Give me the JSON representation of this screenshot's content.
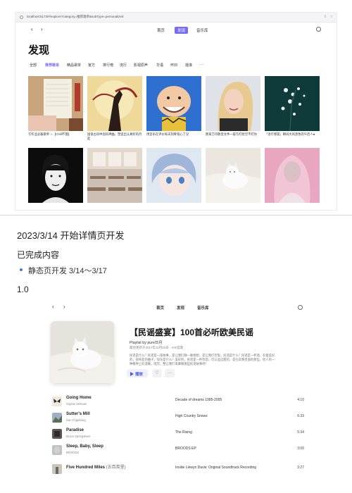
{
  "browser": {
    "url": "localhost:5173/#/explore?category=推荐歌单&subType=personalized"
  },
  "discover_page": {
    "nav_tabs": [
      "首页",
      "发现",
      "音乐库"
    ],
    "active_tab": "发现",
    "title": "发现",
    "categories": [
      "全部",
      "推荐歌单",
      "精品歌单",
      "官方",
      "排行榜",
      "流行",
      "影视原声",
      "华语",
      "怀旧",
      "摇滚",
      "···"
    ],
    "active_category": "推荐歌单",
    "playlists_row1": [
      {
        "caption": "写作业必备歌单 ☆【Chill不饿】",
        "art": "notebook-art"
      },
      {
        "caption": "国语古风中国风神曲，塑造出认真听的月起",
        "art": "moon-swordsman-art"
      },
      {
        "caption": "用音乐在评价每天刻骨铭心了没",
        "art": "charlie-brown-art"
      },
      {
        "caption": "那某万诗歌里文件一般写打给空不打你",
        "art": "blonde-singer-art"
      },
      {
        "caption": "「治疗感冒」瞬间大风黑色的午后人●",
        "art": "night-flowers-art"
      }
    ],
    "playlists_row2": [
      {
        "art": "bw-portrait-art"
      },
      {
        "art": "classroom-art"
      },
      {
        "art": "anime-girl-art"
      },
      {
        "art": "white-cat-art"
      },
      {
        "art": "veil-girl-art"
      }
    ]
  },
  "doc": {
    "heading": "2023/3/14 开始详情页开发",
    "section": "已完成内容",
    "bullet": "静态页开发 3/14～3/17",
    "version": "1.0"
  },
  "playlist_page": {
    "nav_tabs": [
      "首页",
      "发现",
      "音乐库"
    ],
    "title": "【民谣盛宴】100首必听欧美民谣",
    "by": "Playlist by pure日月",
    "updated": "最后更新于2017年11月03日 · 100首歌",
    "description": "民谣是什么？民谣是一部故事，是让我们静一静想想，是让我们宣誓，民谣是什么？民谣是一杯酒，有着美好的，很纯是的曲子，快乐是什么！美好的，民谣是一杯烈酒，可以品出甜的，是在寂寞里面的那些，给人的一种精神上的温暖。唱完，整让我们来聊聊那些民谣故事吧！",
    "play_label": "播放",
    "like_icon": "heart-icon",
    "more_label": "···",
    "tracks": [
      {
        "name": "Going Home",
        "alt": "",
        "artist": "Sophie Zelmani",
        "album": "Decade of dreams 1995-2005",
        "duration": "4:10",
        "art": "butterfly-thumb"
      },
      {
        "name": "Sutter's Mill",
        "alt": "",
        "artist": "Dan Fogelberg",
        "album": "High Country Snows",
        "duration": "6:33",
        "art": "mountain-thumb"
      },
      {
        "name": "Paradise",
        "alt": "",
        "artist": "Bruce Springsteen",
        "album": "The Rising",
        "duration": "5:34",
        "art": "dark-thumb"
      },
      {
        "name": "Sleep, Baby, Sleep",
        "alt": "",
        "artist": "BROODS",
        "album": "BROODS EP",
        "duration": "3:00",
        "art": "face-thumb"
      },
      {
        "name": "Five Hundred Miles",
        "alt": "(五百英里)",
        "artist": "",
        "album": "Inside Llewyn Davis: Original Soundtrack Recording",
        "duration": "3:27",
        "art": "street-thumb"
      }
    ]
  }
}
